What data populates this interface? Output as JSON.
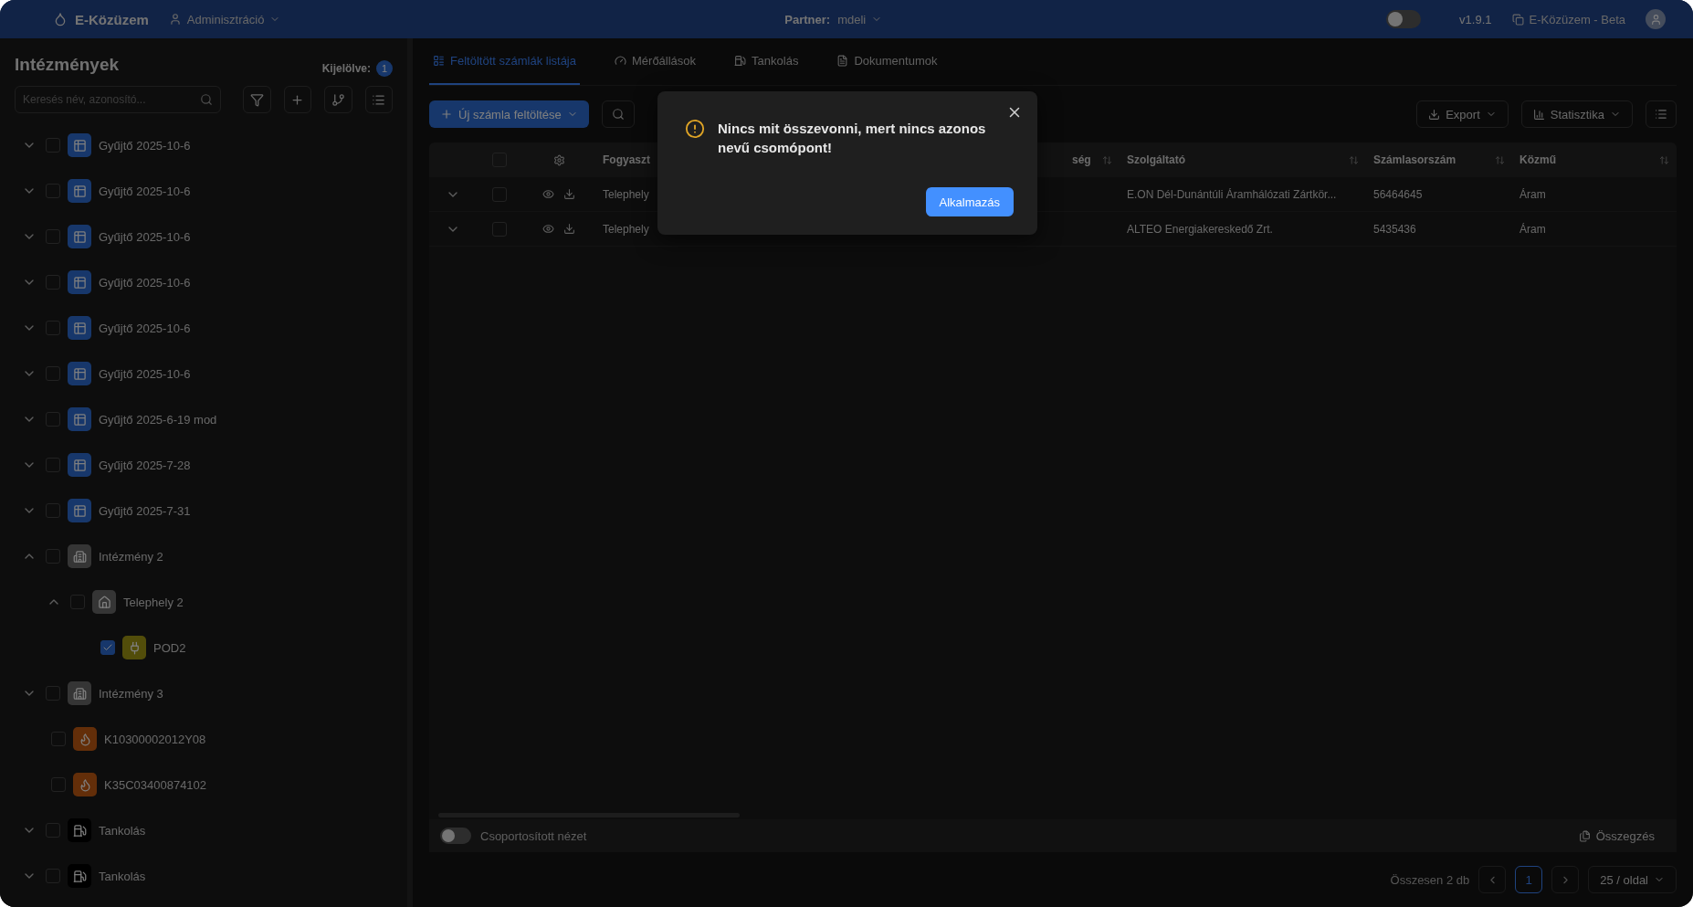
{
  "header": {
    "app_name": "E-Közüzem",
    "menu": "Adminisztráció",
    "partner_label": "Partner:",
    "partner_value": "mdeli",
    "theme_toggle_on": false,
    "version": "v1.9.1",
    "env_link": "E-Közüzem - Beta"
  },
  "sidebar": {
    "title": "Intézmények",
    "selected_label": "Kijelölve:",
    "selected_count": "1",
    "search": {
      "placeholder": "Keresés név, azonosító..."
    },
    "tree": [
      {
        "label": "Gyűjtő 2025-10-6",
        "kind": "collector",
        "expanded": false,
        "checked": false
      },
      {
        "label": "Gyűjtő 2025-10-6",
        "kind": "collector",
        "expanded": false,
        "checked": false
      },
      {
        "label": "Gyűjtő 2025-10-6",
        "kind": "collector",
        "expanded": false,
        "checked": false
      },
      {
        "label": "Gyűjtő 2025-10-6",
        "kind": "collector",
        "expanded": false,
        "checked": false
      },
      {
        "label": "Gyűjtő 2025-10-6",
        "kind": "collector",
        "expanded": false,
        "checked": false
      },
      {
        "label": "Gyűjtő 2025-10-6",
        "kind": "collector",
        "expanded": false,
        "checked": false
      },
      {
        "label": "Gyűjtő 2025-6-19 mod",
        "kind": "collector",
        "expanded": false,
        "checked": false
      },
      {
        "label": "Gyűjtő 2025-7-28",
        "kind": "collector",
        "expanded": false,
        "checked": false
      },
      {
        "label": "Gyűjtő 2025-7-31",
        "kind": "collector",
        "expanded": false,
        "checked": false
      },
      {
        "label": "Intézmény 2",
        "kind": "institution",
        "expanded": true,
        "checked": false,
        "children": [
          {
            "label": "Telephely 2",
            "kind": "site",
            "expanded": true,
            "checked": false,
            "children": [
              {
                "label": "POD2",
                "kind": "pod",
                "checked": true
              }
            ]
          }
        ]
      },
      {
        "label": "Intézmény 3",
        "kind": "institution",
        "expanded": false,
        "checked": false
      },
      {
        "label": "K10300002012Y08",
        "kind": "gas",
        "checked": false
      },
      {
        "label": "K35C03400874102",
        "kind": "gas",
        "checked": false
      },
      {
        "label": "Tankolás",
        "kind": "fuel",
        "expanded": false,
        "checked": false
      },
      {
        "label": "Tankolás",
        "kind": "fuel",
        "expanded": false,
        "checked": false
      }
    ]
  },
  "tabs": [
    {
      "label": "Feltöltött számlák listája",
      "selected": true
    },
    {
      "label": "Mérőállások",
      "selected": false
    },
    {
      "label": "Tankolás",
      "selected": false
    },
    {
      "label": "Dokumentumok",
      "selected": false
    }
  ],
  "toolbar": {
    "upload_button": "Új számla feltöltése",
    "export_button": "Export",
    "stats_button": "Statisztika"
  },
  "table": {
    "all_checked": false,
    "columns": [
      "Fogyaszt",
      "ség",
      "Szolgáltató",
      "Számlasorszám",
      "Közmű"
    ],
    "rows": [
      {
        "cells": [
          "Telephely",
          "",
          "E.ON Dél-Dunántúli Áramhálózati Zártkör...",
          "56464645",
          "Áram"
        ],
        "checked": false
      },
      {
        "cells": [
          "Telephely",
          "",
          "ALTEO Energiakereskedő Zrt.",
          "5435436",
          "Áram"
        ],
        "checked": false
      }
    ]
  },
  "footer": {
    "grouped_view_label": "Csoportosított nézet",
    "grouped_view_on": false,
    "summary_button": "Összegzés",
    "total": "Összesen 2 db",
    "pages": [
      {
        "label": "1",
        "selected": true
      }
    ],
    "page_size": "25 / oldal"
  },
  "dialog": {
    "message": "Nincs mit összevonni, mert nincs azonos nevű csomópont!",
    "apply_button": "Alkalmazás"
  }
}
